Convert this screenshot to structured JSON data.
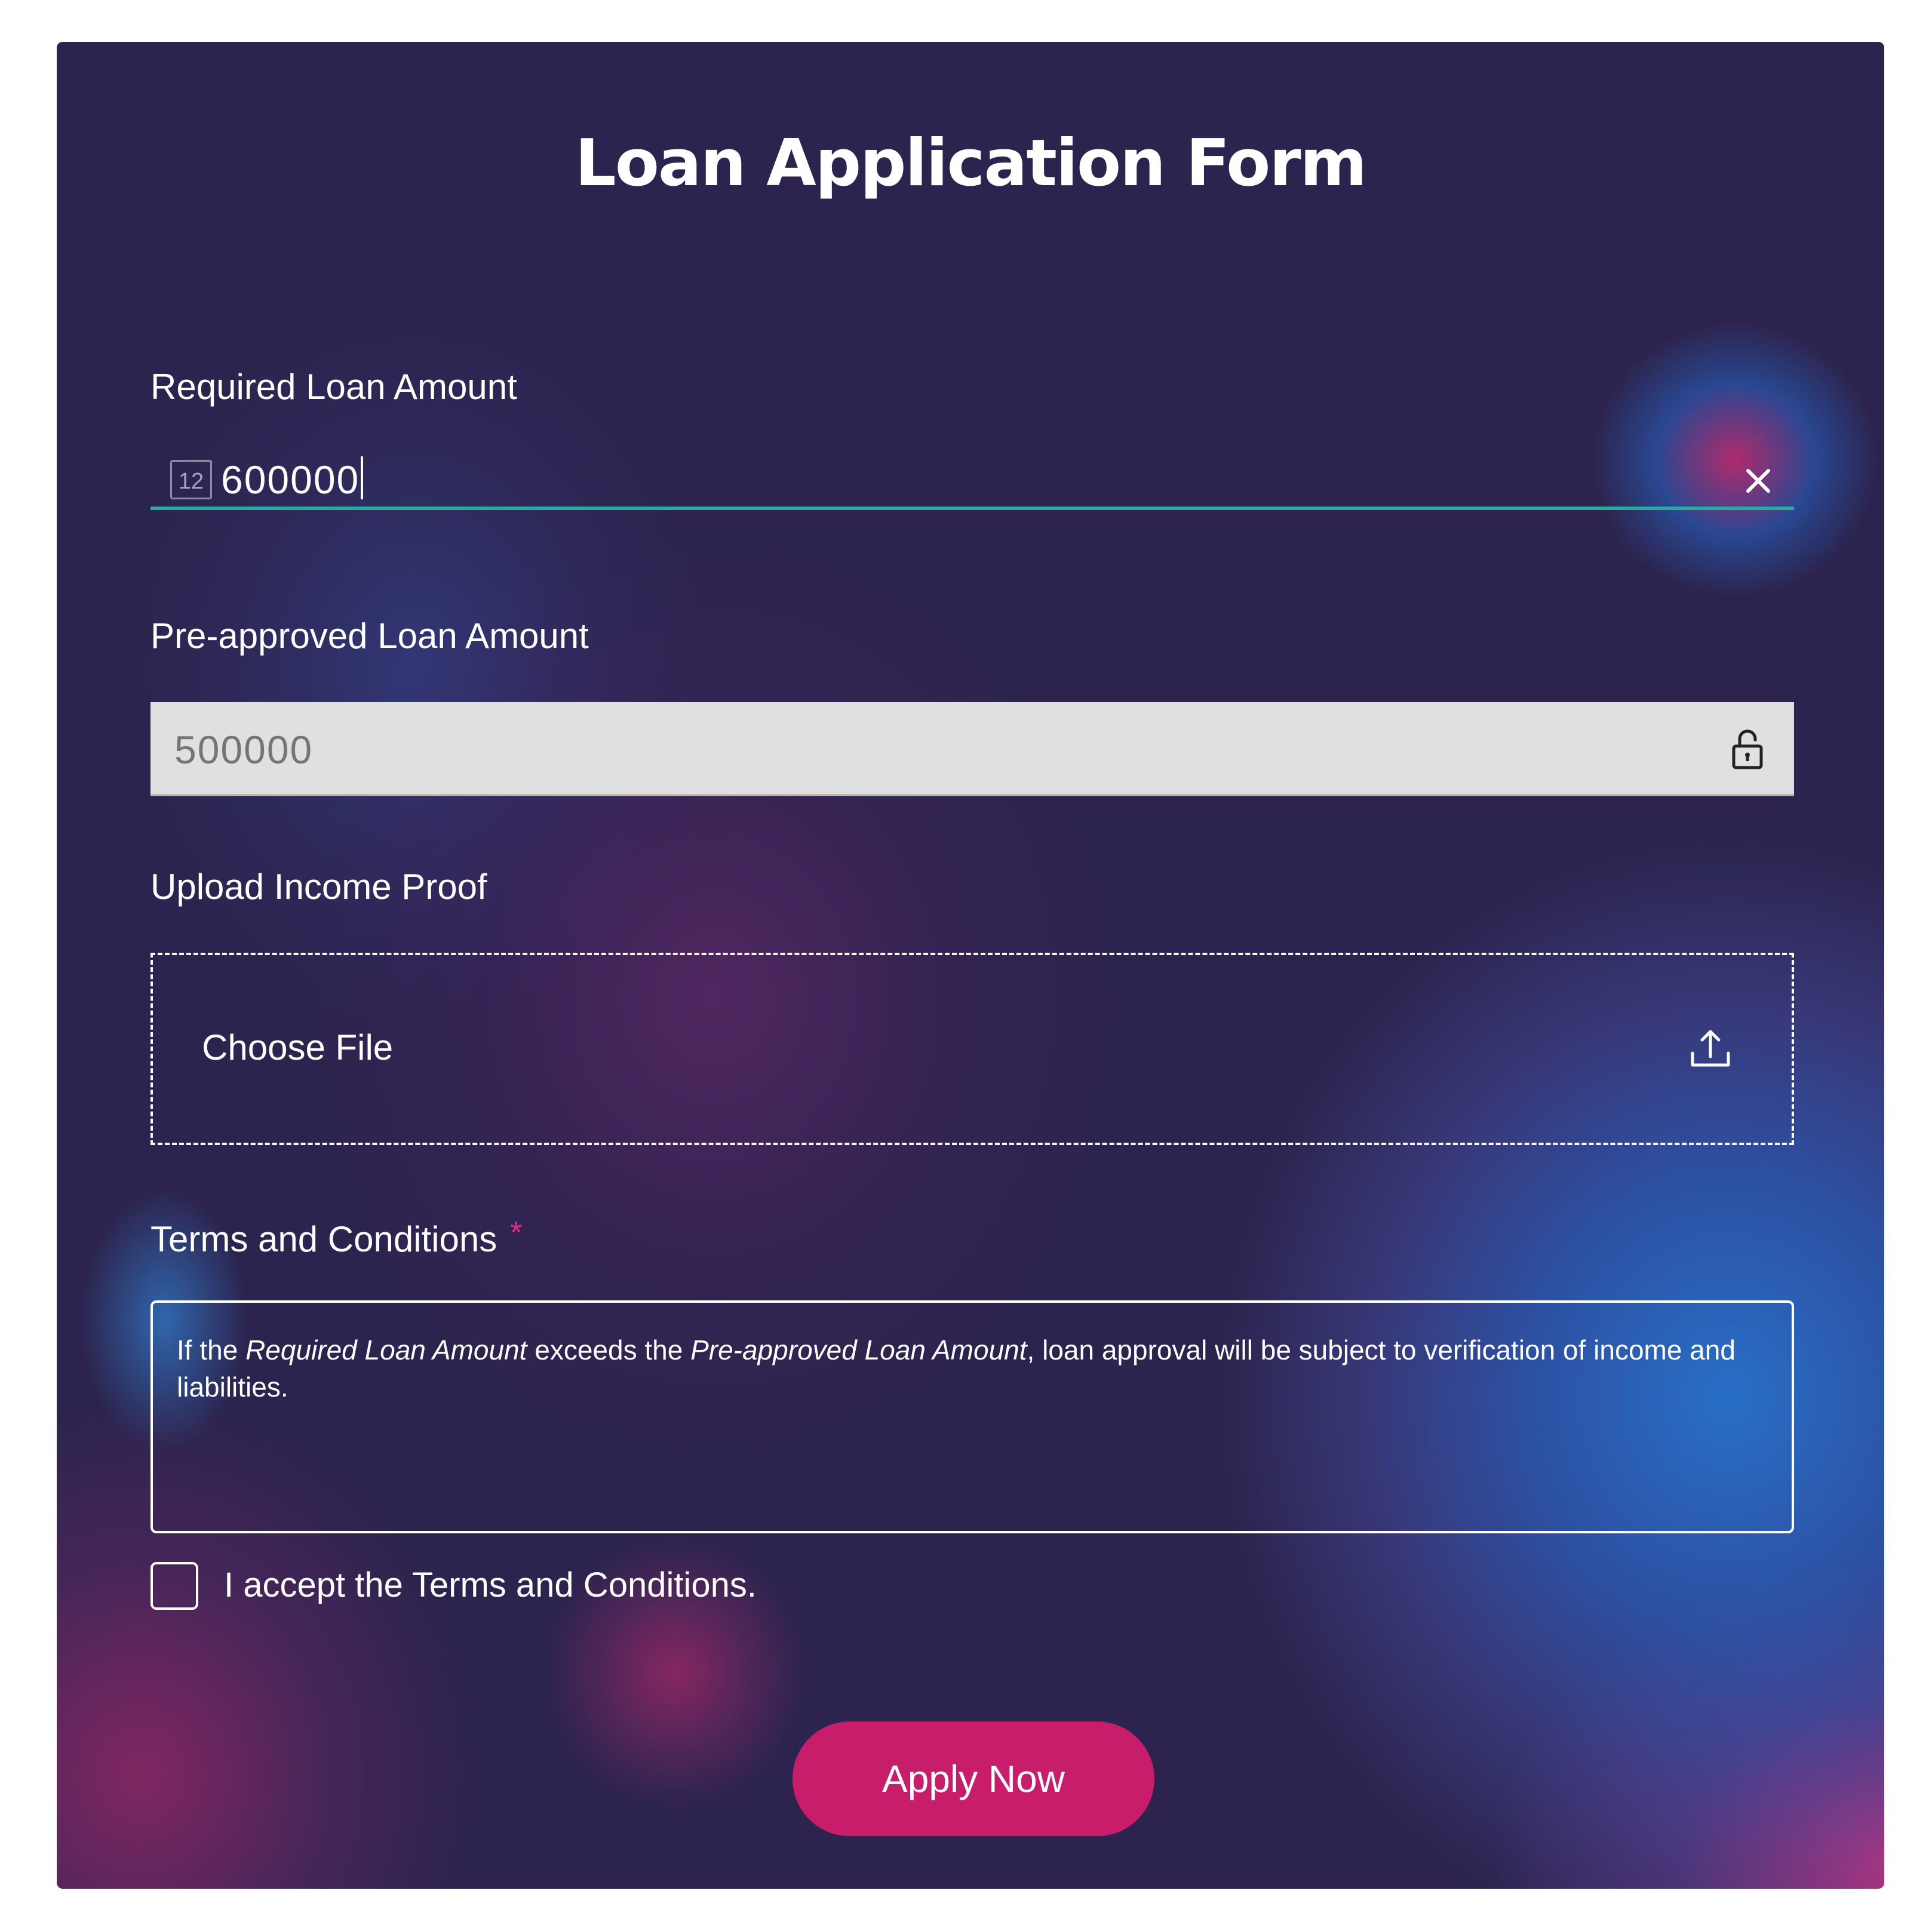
{
  "form": {
    "title": "Loan Application Form",
    "required_amount": {
      "label": "Required Loan Amount",
      "type_icon_text": "12",
      "value": "600000",
      "clear_icon": "close-icon"
    },
    "preapproved_amount": {
      "label": "Pre-approved Loan Amount",
      "value": "500000",
      "lock_icon": "lock-icon"
    },
    "income_proof": {
      "label": "Upload Income Proof",
      "button_text": "Choose File",
      "upload_icon": "upload-icon"
    },
    "terms": {
      "label": "Terms and Conditions",
      "required_marker": "*",
      "text_parts": [
        "If the ",
        "Required Loan Amount",
        " exceeds the ",
        "Pre-approved Loan Amount",
        ", loan approval will be subject to verification of income and liabilities."
      ],
      "accept_label": "I accept the Terms and Conditions.",
      "accepted": false
    },
    "submit_label": "Apply Now"
  },
  "colors": {
    "background": "#2c244e",
    "accent_pink": "#c81d6a",
    "required_marker": "#e0307d",
    "active_underline": "#2aa9a0",
    "disabled_field": "#e0e0e0"
  }
}
